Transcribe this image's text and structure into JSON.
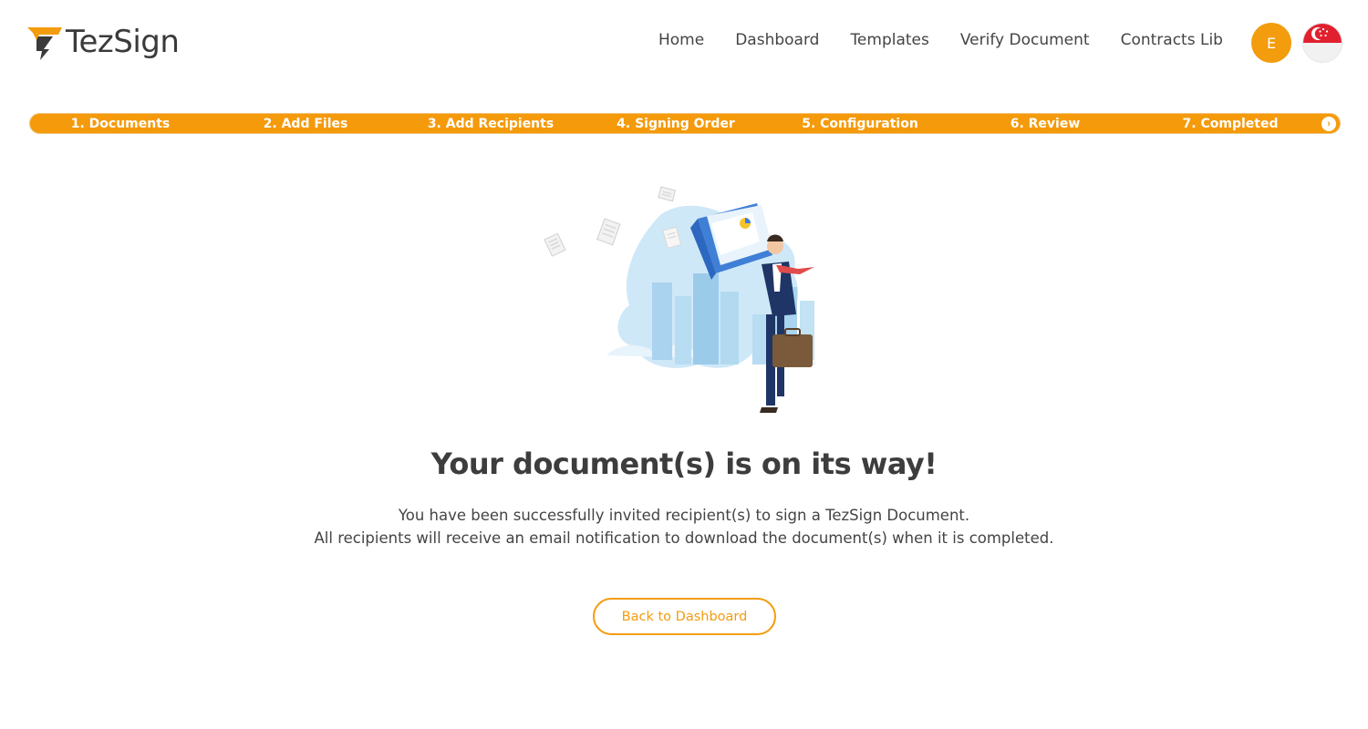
{
  "header": {
    "brand": "TezSign",
    "nav": [
      "Home",
      "Dashboard",
      "Templates",
      "Verify Document",
      "Contracts Lib"
    ],
    "avatar_initial": "E",
    "brand_color": "#f39c0d"
  },
  "stepper": {
    "steps": [
      "1. Documents",
      "2. Add Files",
      "3. Add Recipients",
      "4. Signing Order",
      "5. Configuration",
      "6. Review",
      "7. Completed"
    ],
    "next_icon": "chevron-right-icon"
  },
  "main": {
    "title": "Your document(s) is on its way!",
    "message_line1": "You have been successfully invited recipient(s) to sign a TezSign Document.",
    "message_line2": "All recipients will receive an email notification to download the document(s) when it is completed.",
    "back_button": "Back to Dashboard"
  }
}
